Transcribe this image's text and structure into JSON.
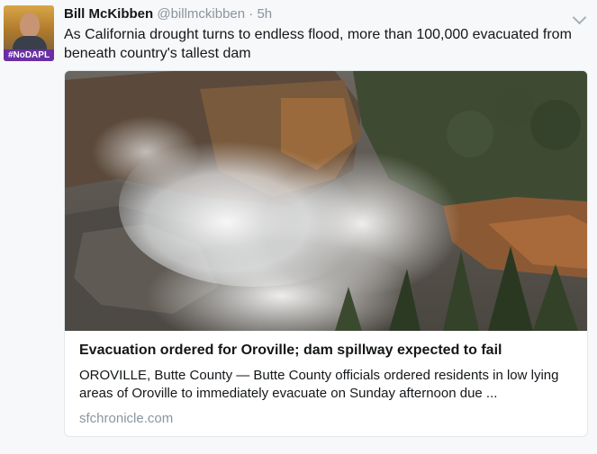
{
  "tweet": {
    "author_name": "Bill McKibben",
    "handle": "@billmckibben",
    "separator": "·",
    "time": "5h",
    "avatar_tag": "#NoDAPL",
    "text": "As California drought turns to endless flood, more than 100,000 evacuated from beneath country's tallest dam"
  },
  "card": {
    "title": "Evacuation ordered for Oroville; dam spillway expected to fail",
    "description": "OROVILLE, Butte County — Butte County officials ordered residents in low lying areas of Oroville to immediately evacuate on Sunday afternoon due ...",
    "domain": "sfchronicle.com"
  },
  "icons": {
    "more": "chevron-down-icon"
  },
  "colors": {
    "background": "#f7f8fa",
    "secondary_text": "#8a959e",
    "avatar_tag": "#6a2fa5",
    "card_border": "#e1e8ed"
  }
}
